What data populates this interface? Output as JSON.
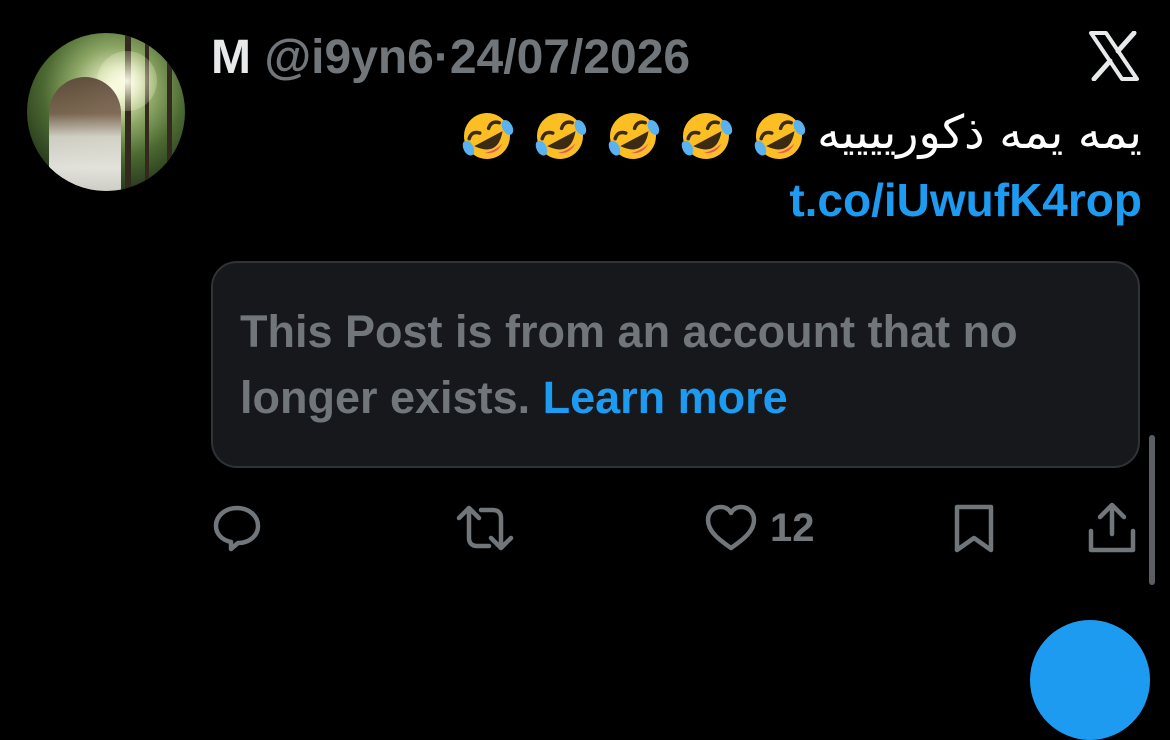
{
  "post": {
    "display_name": "M",
    "handle": "@i9yn6",
    "separator": "·",
    "date": "24/07/2026",
    "text": "يمه يمه ذكورييييه",
    "emoji_count": 5,
    "emoji_icon": "rolling-on-floor-laughing-emoji",
    "link": "t.co/iUwufK4rop"
  },
  "quote": {
    "message": "This Post is from an account that no longer exists.",
    "learn_more": "Learn more"
  },
  "actions": {
    "reply_icon": "reply-icon",
    "repost_icon": "repost-icon",
    "like_icon": "heart-icon",
    "like_count": "12",
    "bookmark_icon": "bookmark-icon",
    "share_icon": "share-icon"
  },
  "colors": {
    "background": "#000000",
    "text_primary": "#e7e9ea",
    "text_secondary": "#71767b",
    "accent": "#1d9bf0",
    "card_bg": "#16181c",
    "card_border": "#2f3336"
  }
}
